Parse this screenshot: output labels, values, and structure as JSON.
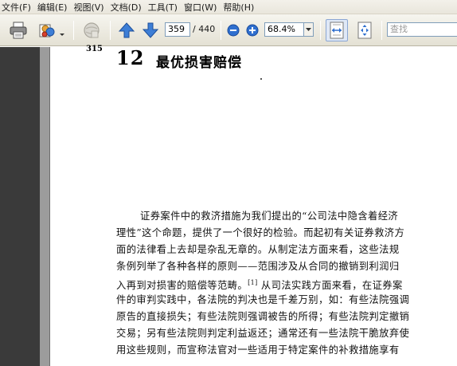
{
  "menu": {
    "items": [
      "文件(F)",
      "编辑(E)",
      "视图(V)",
      "文档(D)",
      "工具(T)",
      "窗口(W)",
      "帮助(H)"
    ]
  },
  "toolbar": {
    "page_current": "359",
    "page_total": "/ 440",
    "zoom_value": "68.4%",
    "search_placeholder": "查找"
  },
  "icons": {
    "print": "printer-icon",
    "share": "share-icon",
    "disabled": "globe-disabled-icon",
    "prev": "arrow-up-icon",
    "next": "arrow-down-icon",
    "zoom_out": "zoom-out-icon",
    "zoom_in": "zoom-in-icon",
    "fit_width": "fit-width-icon",
    "fit_page": "fit-page-icon"
  },
  "colors": {
    "arrow_blue": "#3d7ed6",
    "zoom_blue": "#2f6fcf"
  },
  "document": {
    "page_number": "315",
    "chapter_number": "12",
    "chapter_title": "最优损害赔偿",
    "lines": [
      "证券案件中的救济措施为我们提出的“公司法中隐含着经济",
      "理性”这个命题，提供了一个很好的检验。而起初有关证券救济方",
      "面的法律看上去却是杂乱无章的。从制定法方面来看，这些法规",
      "条例列举了各种各样的原则——范围涉及从合同的撤销到利润归",
      "入再到对损害的赔偿等范畴。",
      "件的审判实践中，各法院的判决也是千差万别，如：有些法院强调",
      "原告的直接损失；有些法院则强调被告的所得；有些法院判定撤销",
      "交易；另有些法院则判定利益返还；通常还有一些法院干脆放弃使",
      "用这些规则，而宣称法官对一些适用于特定案件的补救措施享有"
    ],
    "footnote_mark": "[1]",
    "line5_tail": "从司法实践方面来看，在证券案"
  }
}
